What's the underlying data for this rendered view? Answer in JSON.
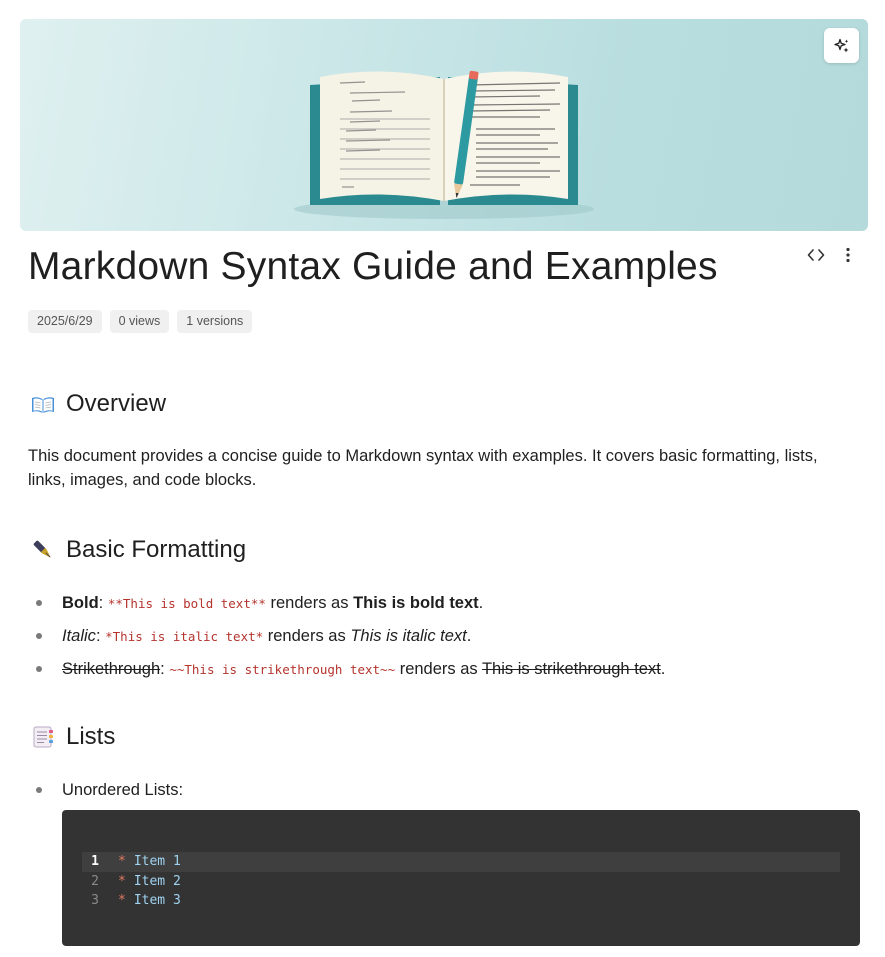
{
  "document": {
    "title": "Markdown Syntax Guide and Examples",
    "meta": {
      "date": "2025/6/29",
      "views": "0 views",
      "versions": "1 versions"
    }
  },
  "icons": {
    "banner_action": "sparkle-icon",
    "view_source": "code-icon",
    "more": "more-vertical-icon",
    "overview": "open-book-emoji",
    "formatting": "fountain-pen-emoji",
    "lists": "bookmark-tabs-emoji"
  },
  "sections": {
    "overview": {
      "heading": "Overview",
      "text": "This document provides a concise guide to Markdown syntax with examples. It covers basic formatting, lists, links, images, and code blocks."
    },
    "formatting": {
      "heading": "Basic Formatting",
      "items": [
        {
          "label": "Bold",
          "sep": ":",
          "code": "**This is bold text**",
          "renders": "renders as",
          "result": "This is bold text",
          "end": "."
        },
        {
          "label": "Italic",
          "sep": ":",
          "code": "*This is italic text*",
          "renders": "renders as",
          "result": "This is italic text",
          "end": "."
        },
        {
          "label": "Strikethrough",
          "sep": ":",
          "code": "~~This is strikethrough text~~",
          "renders": "renders as",
          "result": "This is strikethrough text",
          "end": "."
        }
      ]
    },
    "lists": {
      "heading": "Lists",
      "unordered_label": "Unordered Lists:",
      "code_lines": [
        {
          "num": "1",
          "bullet": "*",
          "text": "Item 1"
        },
        {
          "num": "2",
          "bullet": "*",
          "text": "Item 2"
        },
        {
          "num": "3",
          "bullet": "*",
          "text": "Item 3"
        }
      ]
    }
  },
  "colors": {
    "code_background": "#333333",
    "inline_code": "#b5342e",
    "banner_teal": "#b9dee0"
  }
}
